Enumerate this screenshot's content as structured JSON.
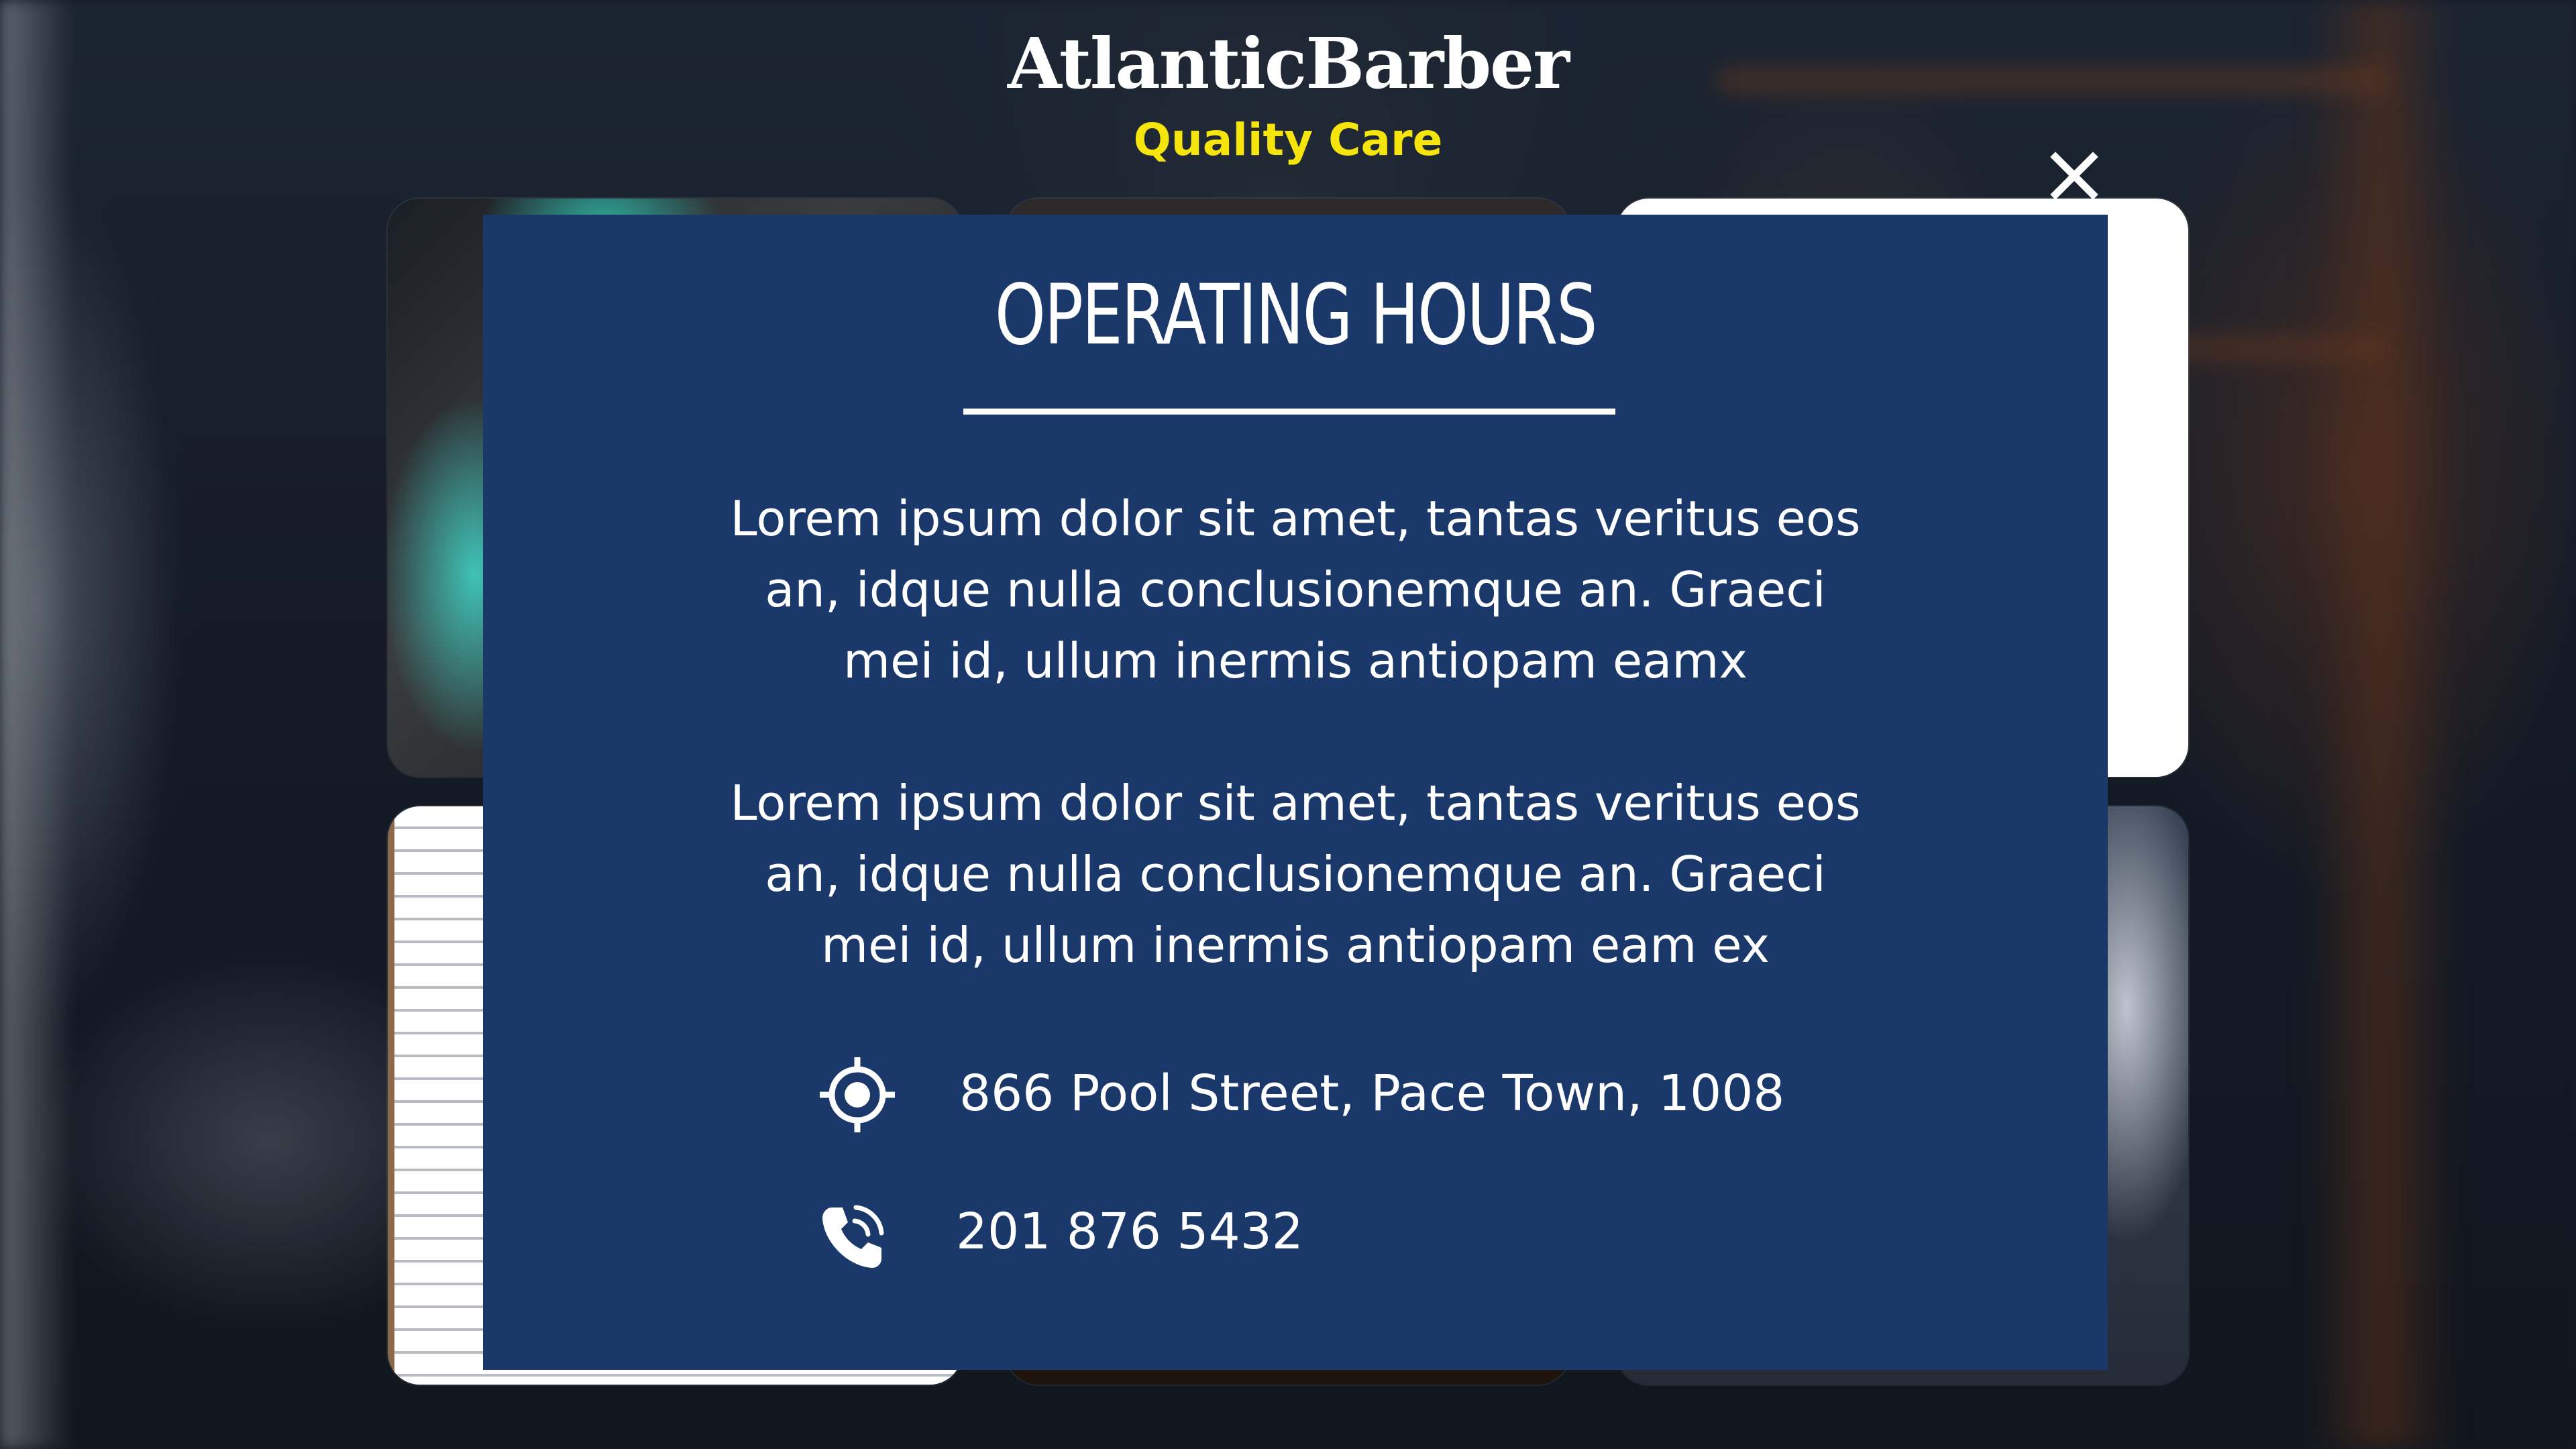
{
  "brand": {
    "name": "AtlanticBarber",
    "tagline": "Quality Care"
  },
  "modal": {
    "title": "OPERATING HOURS",
    "paragraph_1": [
      "Lorem ipsum dolor sit amet, tantas veritus eos",
      "an, idque nulla conclusionemque an. Graeci",
      "mei id, ullum inermis antiopam eamx"
    ],
    "paragraph_2": [
      "Lorem ipsum dolor sit amet, tantas veritus eos",
      "an, idque nulla conclusionemque an. Graeci",
      "mei id, ullum inermis antiopam eam ex"
    ],
    "address": "866 Pool Street, Pace Town, 1008",
    "phone": "201 876 5432"
  },
  "icons": {
    "close": "close-icon",
    "location": "location-target-icon",
    "phone": "phone-ringing-icon"
  },
  "colors": {
    "modal_background": "#1a3869",
    "tagline": "#f5e50c",
    "text": "#ffffff"
  }
}
